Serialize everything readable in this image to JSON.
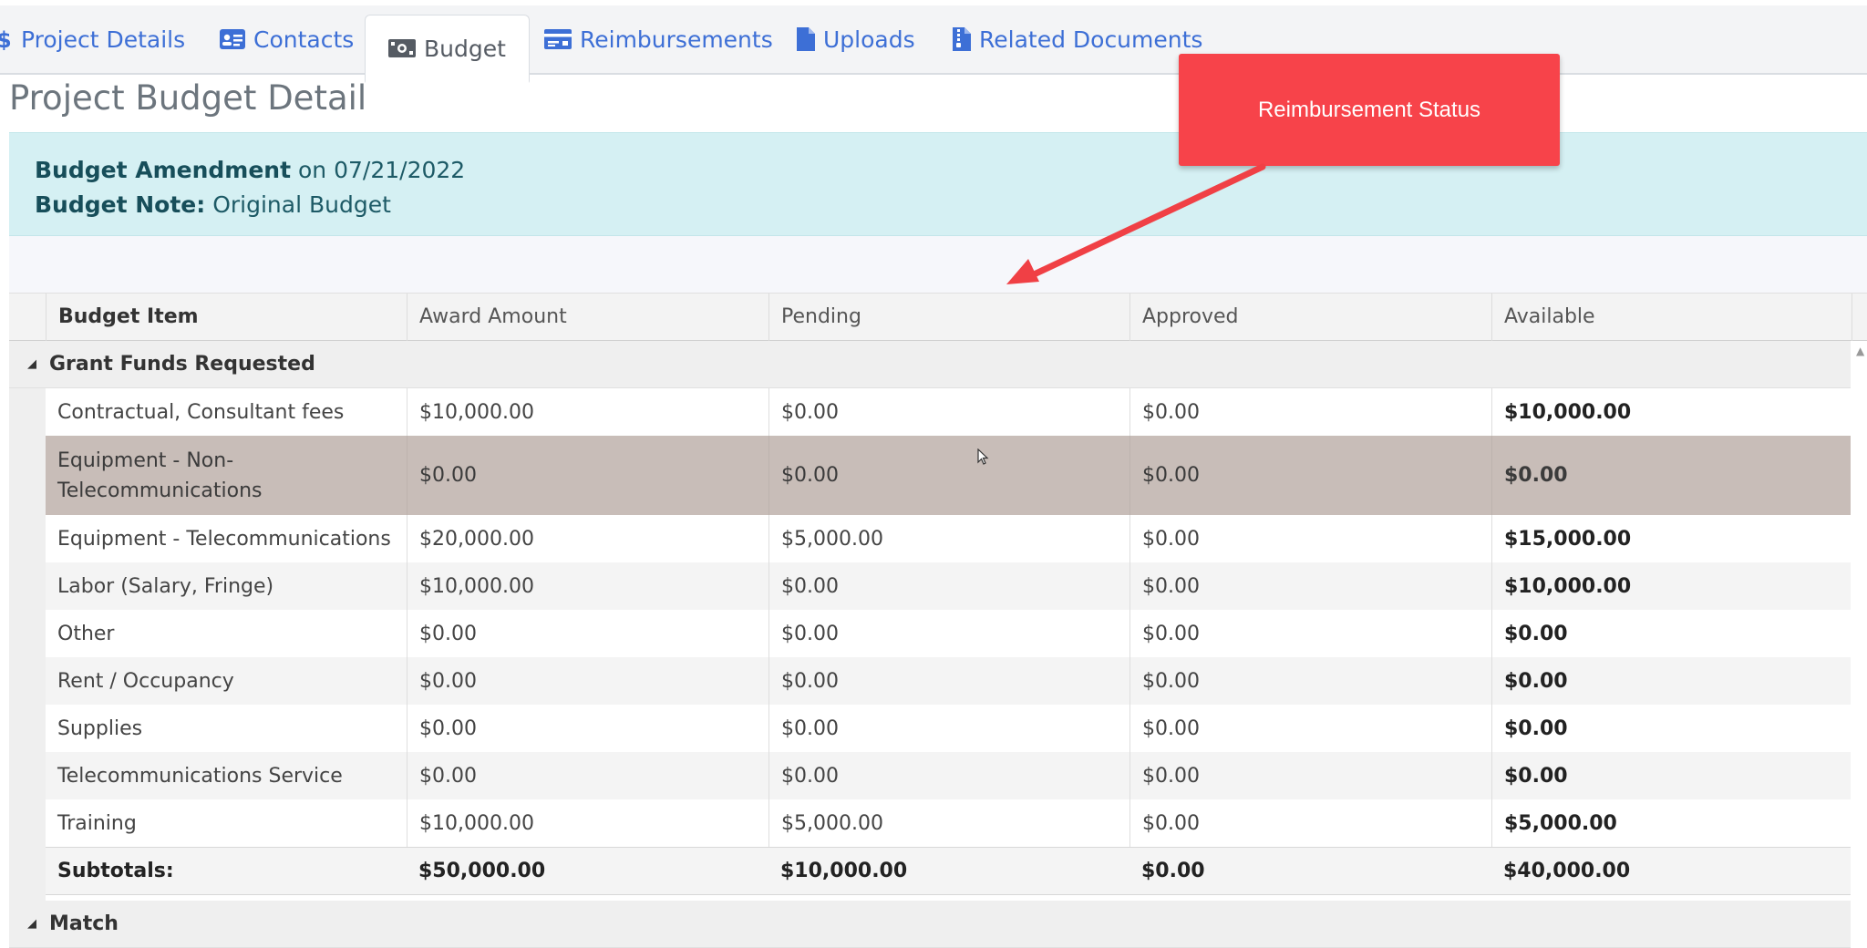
{
  "tabs": [
    {
      "label": "Project Details",
      "icon": "dollar-icon"
    },
    {
      "label": "Contacts",
      "icon": "id-card-icon"
    },
    {
      "label": "Budget",
      "icon": "money-bill-icon"
    },
    {
      "label": "Reimbursements",
      "icon": "receipt-card-icon"
    },
    {
      "label": "Uploads",
      "icon": "file-icon"
    },
    {
      "label": "Related Documents",
      "icon": "file-zipper-icon"
    }
  ],
  "active_tab": "Budget",
  "page_title": "Project Budget Detail",
  "banner": {
    "amendment_label": "Budget Amendment",
    "amendment_date": "on 07/21/2022",
    "note_label": "Budget Note:",
    "note_value": "Original Budget"
  },
  "table": {
    "headers": [
      "Budget Item",
      "Award Amount",
      "Pending",
      "Approved",
      "Available"
    ],
    "groups": [
      {
        "name": "Grant Funds Requested",
        "rows": [
          [
            "Contractual, Consultant fees",
            "$10,000.00",
            "$0.00",
            "$0.00",
            "$10,000.00"
          ],
          [
            "Equipment - Non-Telecommunications",
            "$0.00",
            "$0.00",
            "$0.00",
            "$0.00"
          ],
          [
            "Equipment - Telecommunications",
            "$20,000.00",
            "$5,000.00",
            "$0.00",
            "$15,000.00"
          ],
          [
            "Labor (Salary, Fringe)",
            "$10,000.00",
            "$0.00",
            "$0.00",
            "$10,000.00"
          ],
          [
            "Other",
            "$0.00",
            "$0.00",
            "$0.00",
            "$0.00"
          ],
          [
            "Rent / Occupancy",
            "$0.00",
            "$0.00",
            "$0.00",
            "$0.00"
          ],
          [
            "Supplies",
            "$0.00",
            "$0.00",
            "$0.00",
            "$0.00"
          ],
          [
            "Telecommunications Service",
            "$0.00",
            "$0.00",
            "$0.00",
            "$0.00"
          ],
          [
            "Training",
            "$10,000.00",
            "$5,000.00",
            "$0.00",
            "$5,000.00"
          ]
        ],
        "subtotal": [
          "Subtotals:",
          "$50,000.00",
          "$10,000.00",
          "$0.00",
          "$40,000.00"
        ]
      },
      {
        "name": "Match"
      }
    ]
  },
  "callout": {
    "text": "Reimbursement Status",
    "color": "#f7434a"
  },
  "colors": {
    "link": "#3d6fd6",
    "banner_bg": "#d5f0f3",
    "selected_row": "#c8bdb8"
  }
}
